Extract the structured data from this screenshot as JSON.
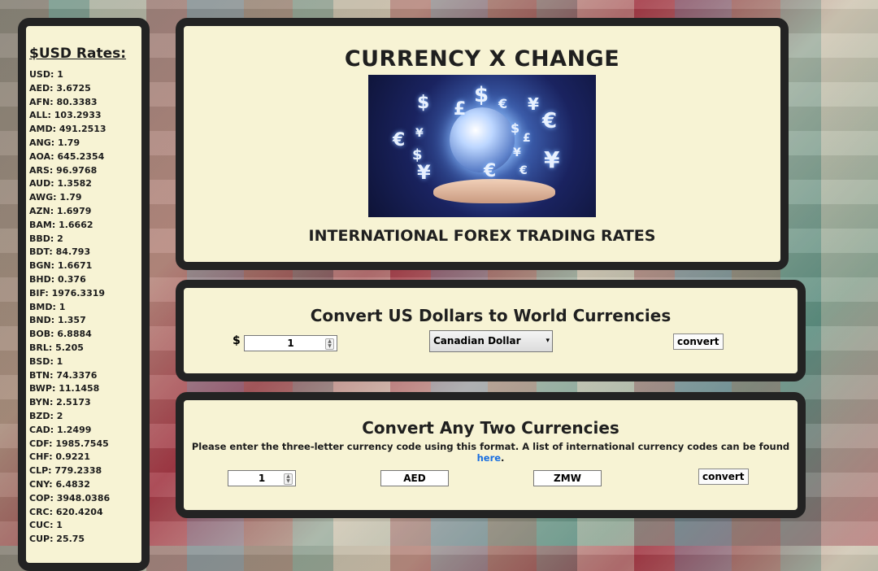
{
  "sidebar": {
    "title": "$USD Rates:",
    "rates": [
      "USD: 1",
      "AED: 3.6725",
      "AFN: 80.3383",
      "ALL: 103.2933",
      "AMD: 491.2513",
      "ANG: 1.79",
      "AOA: 645.2354",
      "ARS: 96.9768",
      "AUD: 1.3582",
      "AWG: 1.79",
      "AZN: 1.6979",
      "BAM: 1.6662",
      "BBD: 2",
      "BDT: 84.793",
      "BGN: 1.6671",
      "BHD: 0.376",
      "BIF: 1976.3319",
      "BMD: 1",
      "BND: 1.357",
      "BOB: 6.8884",
      "BRL: 5.205",
      "BSD: 1",
      "BTN: 74.3376",
      "BWP: 11.1458",
      "BYN: 2.5173",
      "BZD: 2",
      "CAD: 1.2499",
      "CDF: 1985.7545",
      "CHF: 0.9221",
      "CLP: 779.2338",
      "CNY: 6.4832",
      "COP: 3948.0386",
      "CRC: 620.4204",
      "CUC: 1",
      "CUP: 25.75"
    ]
  },
  "header": {
    "title": "CURRENCY X CHANGE",
    "subtitle": "INTERNATIONAL FOREX TRADING RATES",
    "hero_image_icon": "currency-globe-hand-image"
  },
  "convert_usd": {
    "title": "Convert US Dollars to World Currencies",
    "dollar_sign": "$",
    "amount": "1",
    "selected_currency": "Canadian Dollar",
    "convert_label": "convert"
  },
  "convert_any": {
    "title": "Convert Any Two Currencies",
    "instructions": "Please enter the three-letter currency code using this format. A list of international currency codes can be found ",
    "link_text": "here",
    "instructions_end": ".",
    "amount": "1",
    "from_code": "AED",
    "to_code": "ZMW",
    "convert_label": "convert"
  },
  "colors": {
    "panel_bg": "#f7f3d4",
    "panel_border": "#232323",
    "link": "#1a6fe0"
  }
}
